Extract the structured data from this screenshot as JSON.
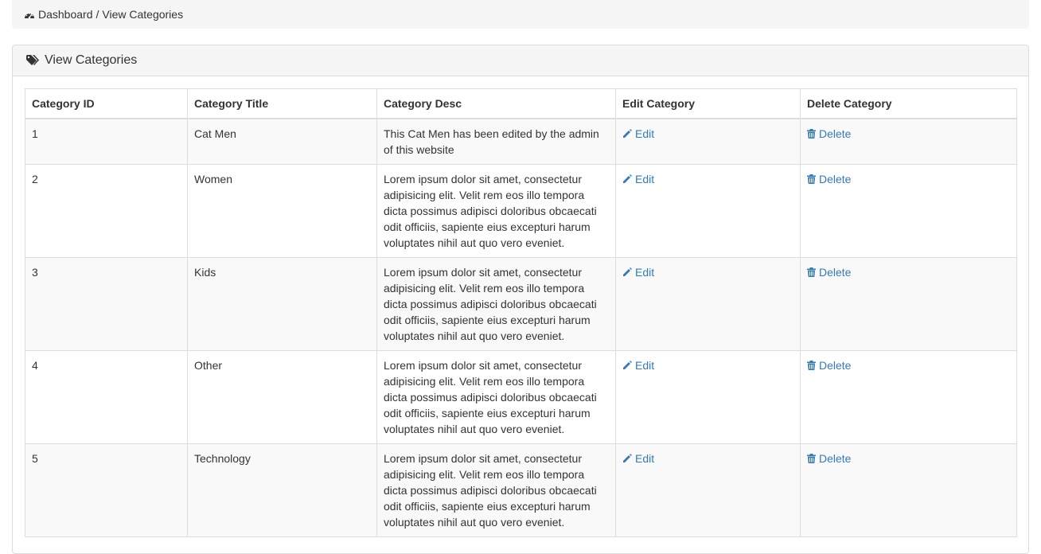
{
  "breadcrumb": {
    "icon": "dashboard-icon",
    "dashboard": "Dashboard",
    "separator": "/",
    "current": "View Categories"
  },
  "panel": {
    "icon": "tags-icon",
    "title": "View Categories"
  },
  "table": {
    "headers": [
      "Category ID",
      "Category Title",
      "Category Desc",
      "Edit Category",
      "Delete Category"
    ],
    "rows": [
      {
        "id": "1",
        "title": "Cat Men",
        "desc": "This Cat Men has been edited by the admin of this website",
        "edit": "Edit",
        "delete": "Delete"
      },
      {
        "id": "2",
        "title": "Women",
        "desc": "Lorem ipsum dolor sit amet, consectetur adipisicing elit. Velit rem eos illo tempora dicta possimus adipisci doloribus obcaecati odit officiis, sapiente eius excepturi harum voluptates nihil aut quo vero eveniet.",
        "edit": "Edit",
        "delete": "Delete"
      },
      {
        "id": "3",
        "title": "Kids",
        "desc": "Lorem ipsum dolor sit amet, consectetur adipisicing elit. Velit rem eos illo tempora dicta possimus adipisci doloribus obcaecati odit officiis, sapiente eius excepturi harum voluptates nihil aut quo vero eveniet.",
        "edit": "Edit",
        "delete": "Delete"
      },
      {
        "id": "4",
        "title": "Other",
        "desc": "Lorem ipsum dolor sit amet, consectetur adipisicing elit. Velit rem eos illo tempora dicta possimus adipisci doloribus obcaecati odit officiis, sapiente eius excepturi harum voluptates nihil aut quo vero eveniet.",
        "edit": "Edit",
        "delete": "Delete"
      },
      {
        "id": "5",
        "title": "Technology",
        "desc": "Lorem ipsum dolor sit amet, consectetur adipisicing elit. Velit rem eos illo tempora dicta possimus adipisci doloribus obcaecati odit officiis, sapiente eius excepturi harum voluptates nihil aut quo vero eveniet.",
        "edit": "Edit",
        "delete": "Delete"
      }
    ]
  },
  "colors": {
    "link": "#337ab7",
    "text": "#333333",
    "border": "#dddddd",
    "stripe": "#f9f9f9",
    "heading_bg": "#f5f5f5"
  }
}
